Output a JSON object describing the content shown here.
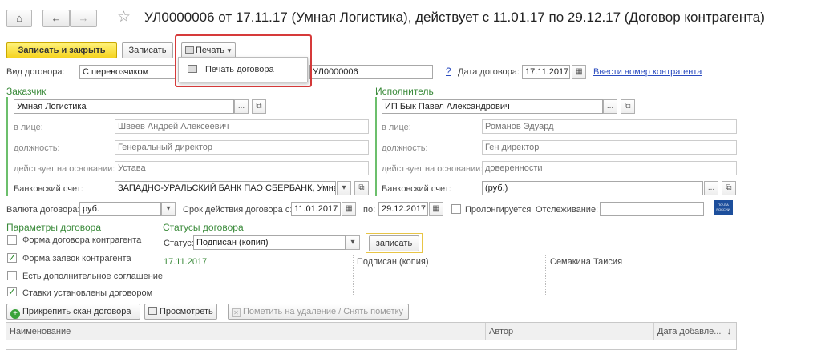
{
  "title": "УЛ0000006 от 17.11.17 (Умная Логистика), действует с 11.01.17 по 29.12.17 (Договор контрагента)",
  "nav": {
    "home": "⌂",
    "back": "←",
    "forward": "→",
    "star": "☆"
  },
  "toolbar": {
    "save_close": "Записать и закрыть",
    "save": "Записать",
    "print": "Печать"
  },
  "print_menu": {
    "item": "Печать договора"
  },
  "contract": {
    "type_label": "Вид договора:",
    "type_value": "С перевозчиком",
    "number_value": "УЛ0000006",
    "help": "?",
    "date_label": "Дата договора:",
    "date_value": "17.11.2017",
    "link": "Ввести номер контрагента"
  },
  "customer": {
    "heading": "Заказчик",
    "name": "Умная Логистика",
    "face_label": "в лице:",
    "face": "Швеев Андрей Алексеевич",
    "position_label": "должность:",
    "position": "Генеральный директор",
    "basis_label": "действует на основании:",
    "basis": "Устава",
    "bank_label": "Банковский счет:",
    "bank": "ЗАПАДНО-УРАЛЬСКИЙ БАНК ПАО СБЕРБАНК, Умная"
  },
  "executor": {
    "heading": "Исполнитель",
    "name": "ИП Бык Павел Александрович",
    "face_label": "в лице:",
    "face": "Романов Эдуард",
    "position_label": "должность:",
    "position": "Ген директор",
    "basis_label": "действует на основании:",
    "basis": "доверенности",
    "bank_label": "Банковский счет:",
    "bank": "(руб.)"
  },
  "currency": {
    "label": "Валюта договора:",
    "value": "руб.",
    "term_label": "Срок действия договора с:",
    "from": "11.01.2017",
    "to_label": "по:",
    "to": "29.12.2017",
    "prolong": "Пролонгируется",
    "tracking_label": "Отслеживание:",
    "post_logo": "ПОЧТА РОССИИ"
  },
  "params": {
    "heading": "Параметры договора",
    "items": [
      {
        "label": "Форма договора контрагента",
        "checked": false
      },
      {
        "label": "Форма заявок контрагента",
        "checked": true
      },
      {
        "label": "Есть дополнительное соглашение",
        "checked": false
      },
      {
        "label": "Ставки установлены договором",
        "checked": true
      }
    ]
  },
  "statuses": {
    "heading": "Статусы договора",
    "status_label": "Статус:",
    "status_value": "Подписан (копия)",
    "save_btn": "записать",
    "row": {
      "date": "17.11.2017",
      "status": "Подписан (копия)",
      "author": "Семакина Таисия"
    }
  },
  "files": {
    "attach": "Прикрепить скан договора",
    "view": "Просмотреть",
    "mark_delete": "Пометить на удаление / Снять пометку",
    "columns": [
      "Наименование",
      "Автор",
      "Дата добавле..."
    ]
  }
}
